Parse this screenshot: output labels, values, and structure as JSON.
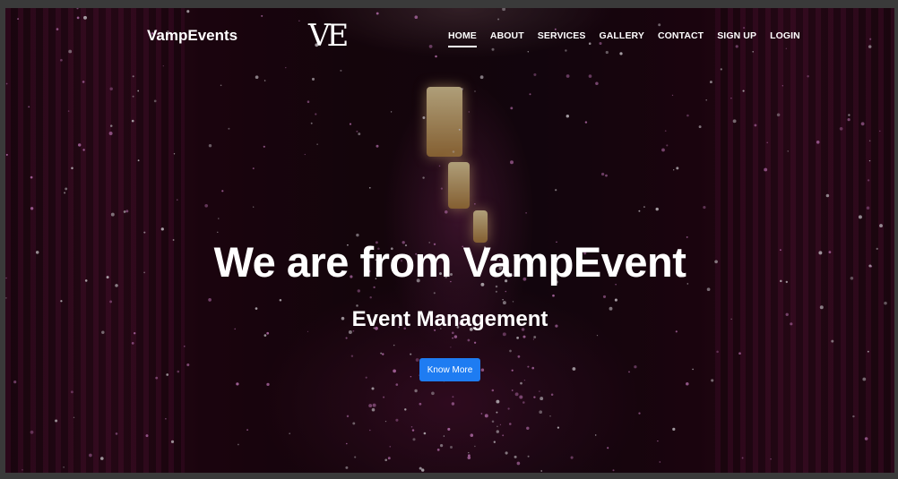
{
  "colors": {
    "accent": "#1e7cf2",
    "text": "#ffffff",
    "background": "#1a0812"
  },
  "nav": {
    "brand": "VampEvents",
    "logo": "VE",
    "items": [
      {
        "label": "HOME",
        "active": true
      },
      {
        "label": "ABOUT"
      },
      {
        "label": "SERVICES"
      },
      {
        "label": "GALLERY"
      },
      {
        "label": "CONTACT"
      },
      {
        "label": "SIGN UP"
      },
      {
        "label": "LOGIN"
      }
    ]
  },
  "hero": {
    "title": "We are from VampEvent",
    "subtitle": "Event Management",
    "cta_label": "Know More"
  }
}
